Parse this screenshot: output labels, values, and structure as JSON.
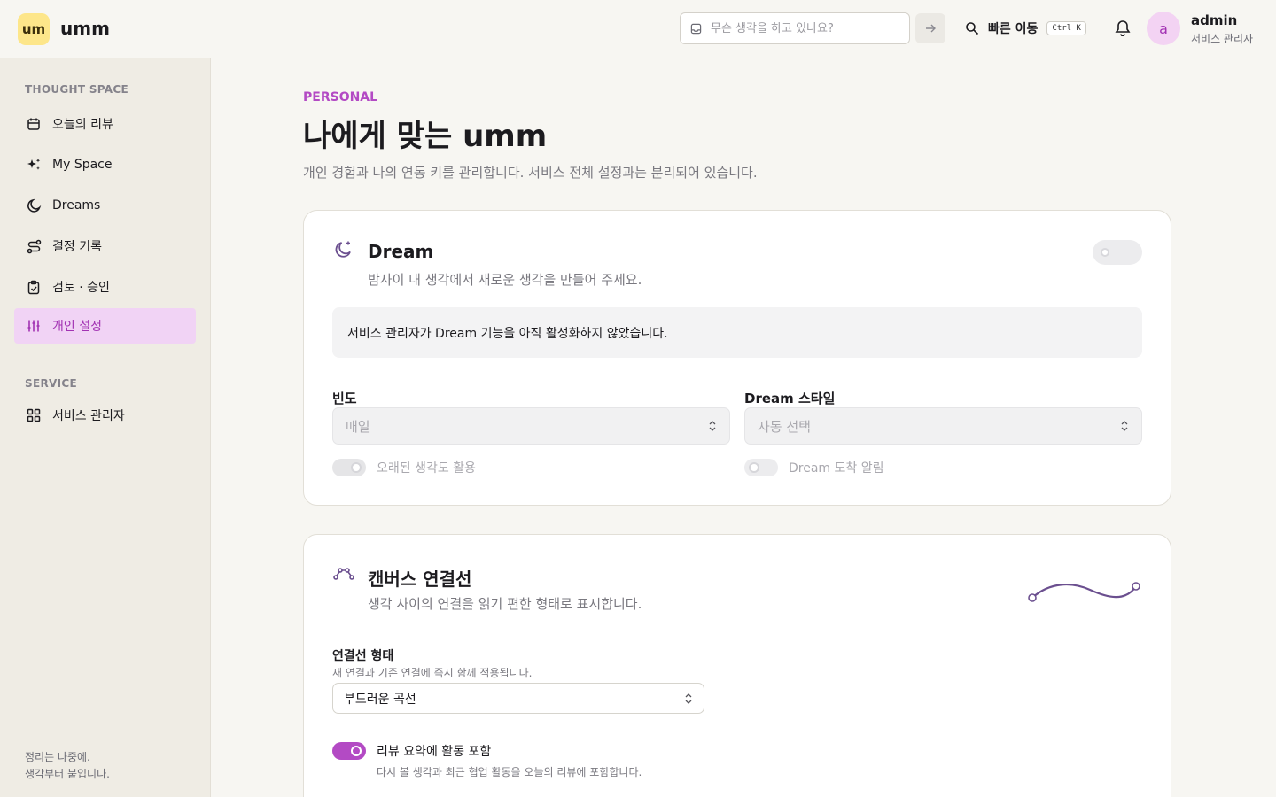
{
  "header": {
    "logo_text": "um",
    "brand": "umm",
    "search_placeholder": "무슨 생각을 하고 있나요?",
    "quick_label": "빠른 이동",
    "quick_shortcut": "Ctrl K",
    "avatar_letter": "a",
    "user_name": "admin",
    "user_role": "서비스 관리자"
  },
  "sidebar": {
    "section1": "THOUGHT SPACE",
    "items": [
      {
        "label": "오늘의 리뷰",
        "icon": "calendar-icon"
      },
      {
        "label": "My Space",
        "icon": "sparkles-icon"
      },
      {
        "label": "Dreams",
        "icon": "moon-icon"
      },
      {
        "label": "결정 기록",
        "icon": "route-icon"
      },
      {
        "label": "검토 · 승인",
        "icon": "clipboard-check-icon"
      },
      {
        "label": "개인 설정",
        "icon": "sliders-icon",
        "active": true
      }
    ],
    "section2": "SERVICE",
    "service_items": [
      {
        "label": "서비스 관리자",
        "icon": "grid-icon"
      }
    ],
    "footer_line1": "정리는 나중에.",
    "footer_line2": "생각부터 붙입니다."
  },
  "page": {
    "kicker": "PERSONAL",
    "title": "나에게 맞는 umm",
    "subtitle": "개인 경험과 나의 연동 키를 관리합니다. 서비스 전체 설정과는 분리되어 있습니다."
  },
  "dream_card": {
    "title": "Dream",
    "description": "밤사이 내 생각에서 새로운 생각을 만들어 주세요.",
    "enabled": false,
    "notice": "서비스 관리자가 Dream 기능을 아직 활성화하지 않았습니다.",
    "frequency_label": "빈도",
    "frequency_value": "매일",
    "style_label": "Dream 스타일",
    "style_value": "자동 선택",
    "old_thoughts_label": "오래된 생각도 활용",
    "arrival_label": "Dream 도착 알림"
  },
  "canvas_card": {
    "title": "캔버스 연결선",
    "description": "생각 사이의 연결을 읽기 편한 형태로 표시합니다.",
    "shape_label": "연결선 형태",
    "shape_hint": "새 연결과 기존 연결에 즉시 함께 적용됩니다.",
    "shape_value": "부드러운 곡선",
    "review_toggle_label": "리뷰 요약에 활동 포함",
    "review_toggle_hint": "다시 볼 생각과 최근 협업 활동을 오늘의 리뷰에 포함합니다.",
    "review_toggle_on": true
  },
  "colors": {
    "accent": "#b34ac4",
    "active_bg": "#f1d3f5",
    "logo_bg": "#fde68a",
    "curve": "#6b4f8f"
  }
}
